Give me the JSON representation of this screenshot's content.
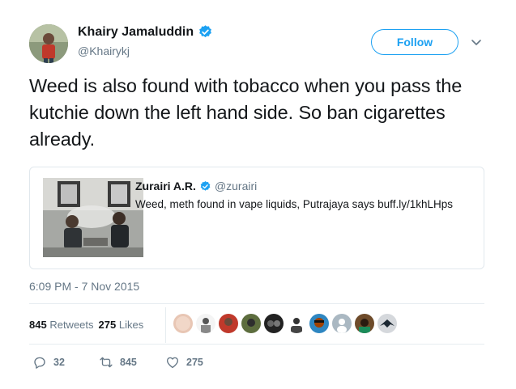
{
  "author": {
    "name": "Khairy Jamaluddin",
    "handle": "@Khairykj",
    "verified_icon": "verified-badge-icon"
  },
  "follow_label": "Follow",
  "tweet_text": "Weed is also found with tobacco when you pass the kutchie down the left hand side. So ban cigarettes already.",
  "quoted": {
    "name": "Zurairi A.R.",
    "handle": "@zurairi",
    "text": "Weed, meth found in vape liquids, Putrajaya says buff.ly/1khLHps"
  },
  "timestamp": "6:09 PM - 7 Nov 2015",
  "stats": {
    "retweets_count": "845",
    "retweets_label": "Retweets",
    "likes_count": "275",
    "likes_label": "Likes"
  },
  "actions": {
    "replies": "32",
    "retweets": "845",
    "likes": "275"
  },
  "colors": {
    "accent": "#1da1f2",
    "secondary_text": "#657786",
    "border": "#e1e8ed"
  }
}
